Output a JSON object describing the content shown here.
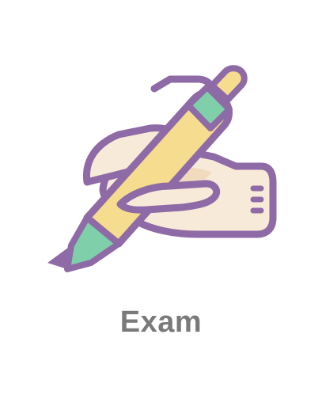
{
  "tile": {
    "label": "Exam",
    "icon": "hand-writing-pen-icon"
  },
  "colors": {
    "outline": "#8e6aa6",
    "skin": "#f8ead8",
    "skin_shadow": "#f1d8bd",
    "pen_body": "#f6dc8f",
    "pen_accent": "#7fcfaa",
    "label": "#7a7a7a"
  }
}
